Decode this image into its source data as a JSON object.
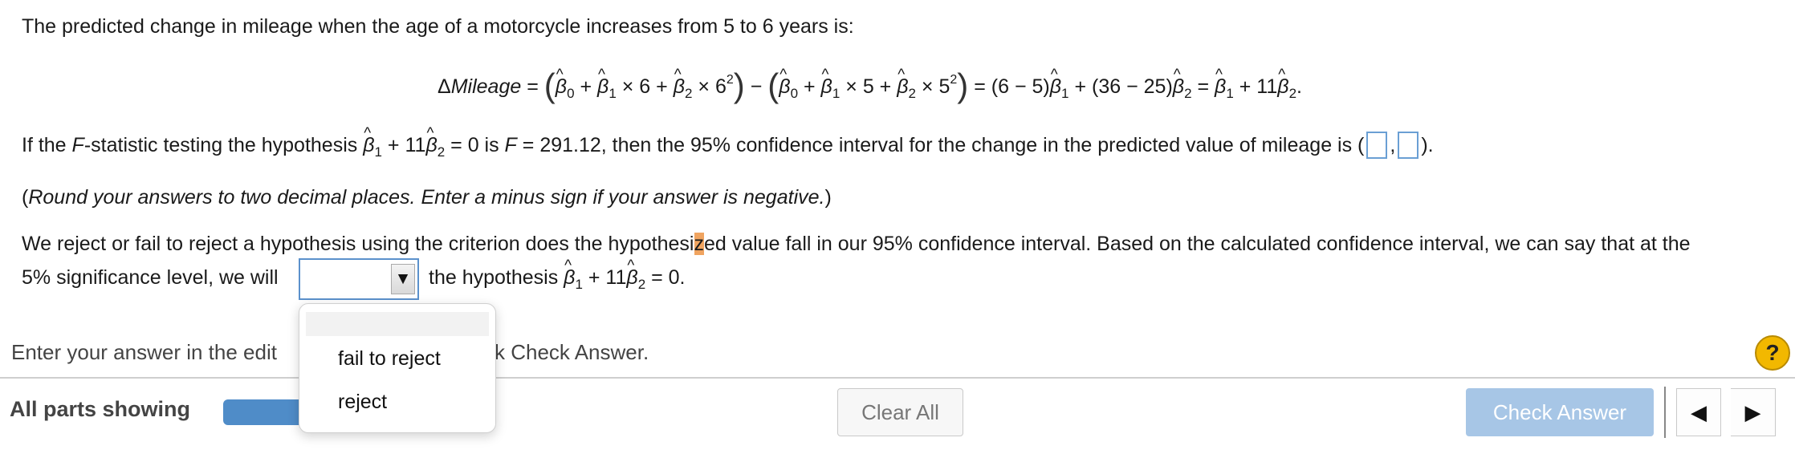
{
  "question": {
    "intro": "The predicted change in mileage when the age of a motorcycle increases from 5 to 6 years is:",
    "equation": {
      "lhs": "ΔMileage",
      "part1_prefix": "β",
      "age1": "6",
      "age0": "5",
      "result_a": "= (6 − 5)",
      "result_b": "+ (36 − 25)",
      "final": "+ 11"
    },
    "ci_text_1": "If the ",
    "ci_text_F": "F",
    "ci_text_2": "-statistic testing the hypothesis ",
    "ci_text_3": " + 11",
    "ci_text_4": " = 0 is ",
    "ci_text_5": " = 291.12, then the 95% confidence interval for the change in the predicted value of mileage is (",
    "ci_comma": ",",
    "ci_close": ").",
    "round_open": "(",
    "round_text": "Round your answers to two decimal places. Enter a minus sign if your answer is negative.",
    "round_close": ")",
    "reject_line1_a": "We reject or fail to reject a hypothesis using the criterion does the hypothesi",
    "reject_line1_hl": "z",
    "reject_line1_b": "ed value fall in our 95% confidence interval. Based on the calculated confidence interval, we can say that at the",
    "reject_line2_a": "5% significance level, we will",
    "reject_line2_b": "the hypothesis",
    "reject_line2_c": "+ 11",
    "reject_line2_d": "= 0."
  },
  "dropdown": {
    "selected": "",
    "arrow": "▼",
    "options": [
      "fail to reject",
      "reject"
    ]
  },
  "footer": {
    "instruction_left": "Enter your answer in the edit",
    "instruction_right": "k Check Answer.",
    "help": "?",
    "all_parts": "All parts showing",
    "clear_all": "Clear All",
    "check_answer": "Check Answer",
    "prev_icon": "◀",
    "next_icon": "▶"
  }
}
